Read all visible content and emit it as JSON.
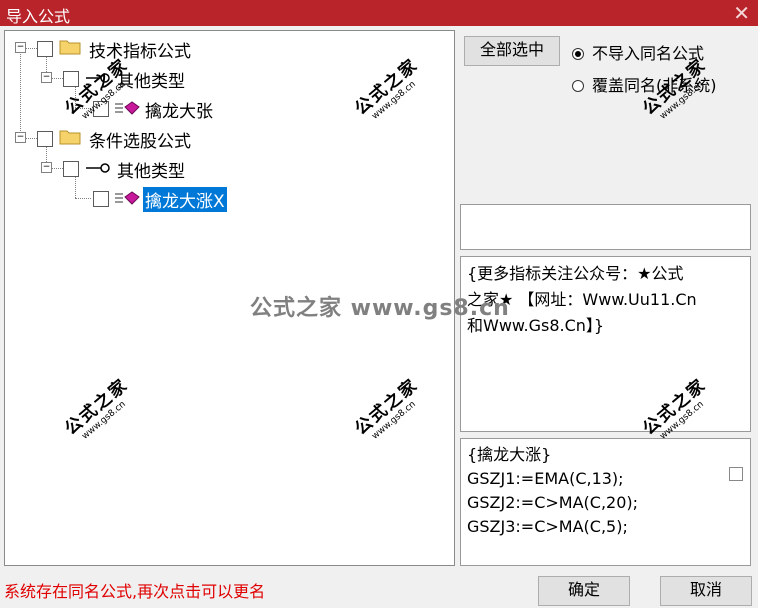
{
  "window": {
    "title": "导入公式",
    "close_glyph": "✕"
  },
  "tree": [
    {
      "label": "技术指标公式",
      "icon": "folder-icon"
    },
    {
      "label": "其他类型",
      "icon": "key-icon"
    },
    {
      "label": "擒龙大张",
      "icon": "formula-icon"
    },
    {
      "label": "条件选股公式",
      "icon": "folder-icon"
    },
    {
      "label": "其他类型",
      "icon": "key-icon"
    },
    {
      "label": "擒龙大涨X",
      "icon": "formula-icon",
      "selected": true
    }
  ],
  "buttons": {
    "select_all": "全部选中",
    "ok": "确定",
    "cancel": "取消"
  },
  "radio": {
    "no_import": "不导入同名公式",
    "overwrite": "覆盖同名(非系统)",
    "selected": "no_import"
  },
  "notice_lines": [
    "{更多指标关注公众号：★公式",
    "之家★ 【网址：Www.Uu11.Cn",
    "和Www.Gs8.Cn】}"
  ],
  "code_lines": [
    "{擒龙大涨}",
    "GSZJ1:=EMA(C,13);",
    "GSZJ2:=C>MA(C,20);",
    "GSZJ3:=C>MA(C,5);"
  ],
  "status_text": "系统存在同名公式,再次点击可以更名",
  "watermark": {
    "brand": "公式之家",
    "url": "www.gs8.cn",
    "center": "公式之家 www.gs8.cn"
  },
  "colors": {
    "titlebar": "#b8242a",
    "selection": "#0078d7",
    "status": "#e00000"
  }
}
